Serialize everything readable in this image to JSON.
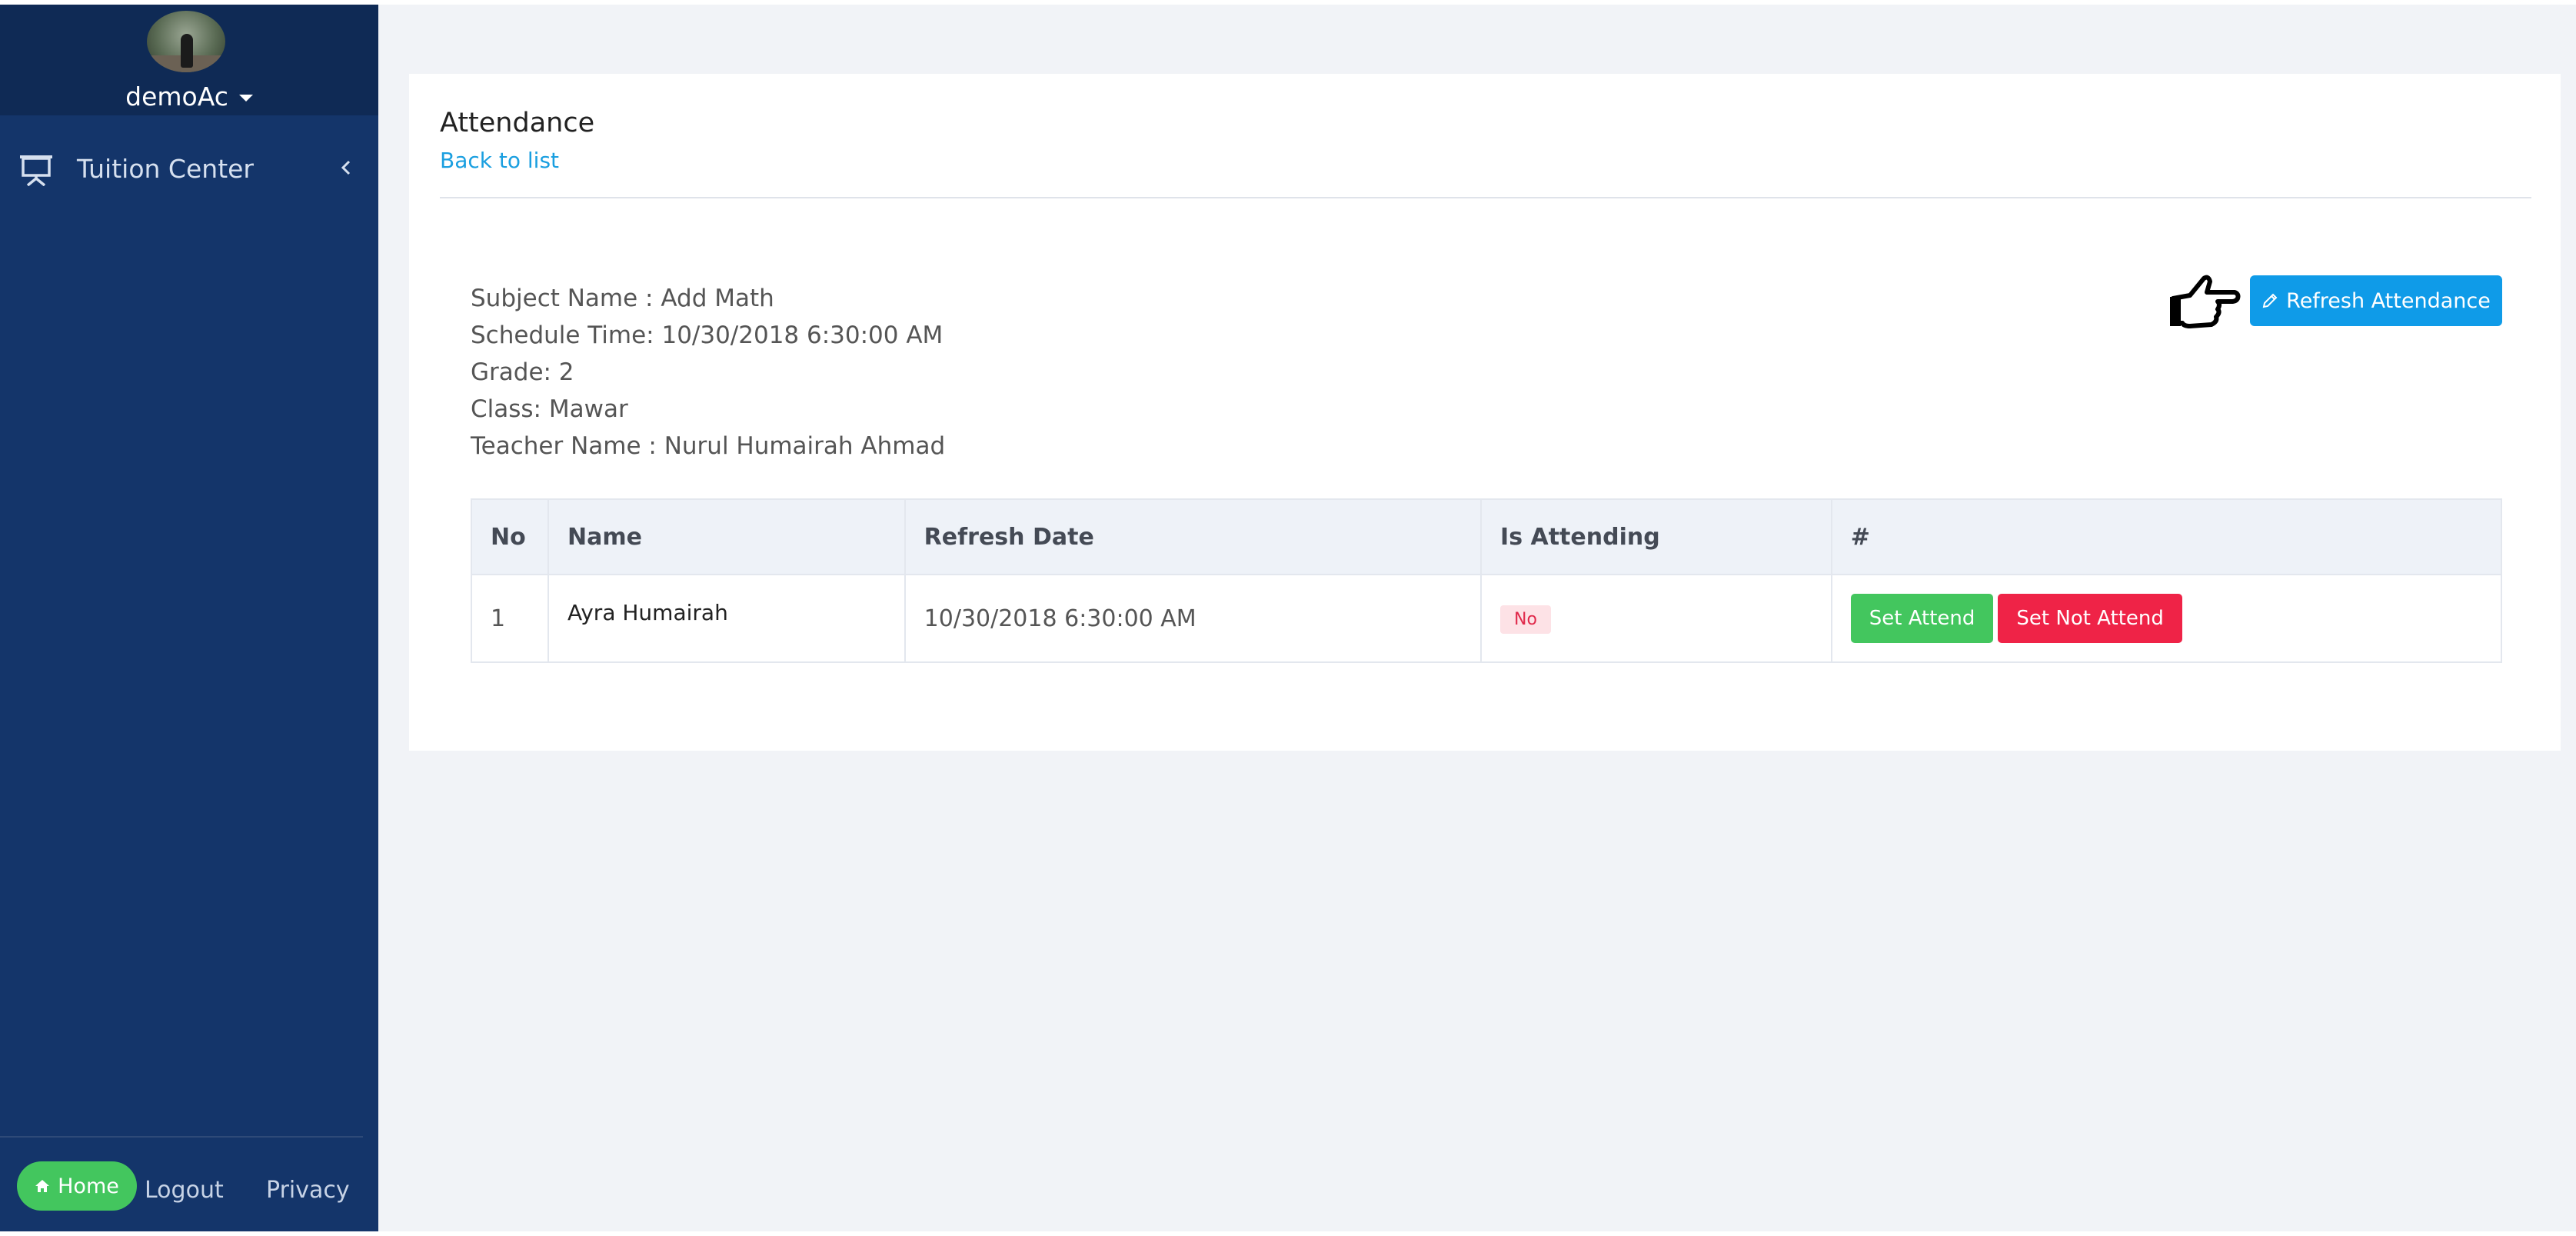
{
  "sidebar": {
    "user_name": "demoAc",
    "nav_items": [
      {
        "label": "Tuition Center",
        "icon": "presentation-board-icon"
      }
    ],
    "footer": {
      "home_label": "Home",
      "logout_label": "Logout",
      "privacy_label": "Privacy"
    }
  },
  "page": {
    "title": "Attendance",
    "back_link": "Back to list",
    "details": {
      "subject": "Subject Name : Add Math",
      "schedule": "Schedule Time: 10/30/2018 6:30:00 AM",
      "grade": "Grade: 2",
      "class": "Class: Mawar",
      "teacher": "Teacher Name : Nurul Humairah Ahmad"
    },
    "refresh_button": "Refresh Attendance"
  },
  "table": {
    "headers": [
      "No",
      "Name",
      "Refresh Date",
      "Is Attending",
      "#"
    ],
    "rows": [
      {
        "no": "1",
        "name": "Ayra Humairah",
        "refresh_date": "10/30/2018 6:30:00 AM",
        "is_attending": "No",
        "set_attend_label": "Set Attend",
        "set_not_attend_label": "Set Not Attend"
      }
    ]
  },
  "colors": {
    "sidebar_bg": "#14356a",
    "sidebar_header_bg": "#0f2a55",
    "primary": "#0f9be8",
    "success": "#43c65e",
    "danger": "#ef2347",
    "link": "#1a9fe0"
  }
}
